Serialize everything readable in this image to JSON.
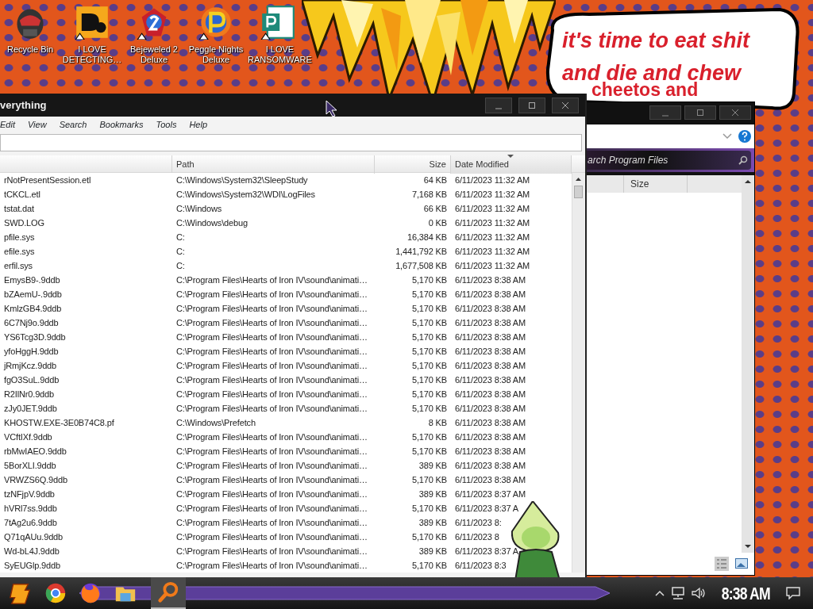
{
  "desktop_icons": [
    {
      "label": "Recycle Bin",
      "kind": "bin"
    },
    {
      "label": "I LOVE DETECTING…",
      "kind": "letters"
    },
    {
      "label": "Bejeweled 2 Deluxe",
      "kind": "gem"
    },
    {
      "label": "Peggle Nights Deluxe",
      "kind": "peggle"
    },
    {
      "label": "I LOVE RANSOMWARE",
      "kind": "project"
    }
  ],
  "speech_bubble": {
    "lines": [
      "it's time to eat shit",
      "and die and chew"
    ],
    "tail": "cheetos and"
  },
  "everything_window": {
    "title": "verything",
    "menu": [
      "Edit",
      "View",
      "Search",
      "Bookmarks",
      "Tools",
      "Help"
    ],
    "columns": [
      {
        "label": "Path",
        "sorted": false
      },
      {
        "label": "Size",
        "sorted": false
      },
      {
        "label": "Date Modified",
        "sorted": true
      }
    ],
    "rows": [
      {
        "name": "rNotPresentSession.etl",
        "path": "C:\\Windows\\System32\\SleepStudy",
        "size": "64 KB",
        "date": "6/11/2023 11:32 AM"
      },
      {
        "name": "tCKCL.etl",
        "path": "C:\\Windows\\System32\\WDI\\LogFiles",
        "size": "7,168 KB",
        "date": "6/11/2023 11:32 AM"
      },
      {
        "name": "tstat.dat",
        "path": "C:\\Windows",
        "size": "66 KB",
        "date": "6/11/2023 11:32 AM"
      },
      {
        "name": "SWD.LOG",
        "path": "C:\\Windows\\debug",
        "size": "0 KB",
        "date": "6/11/2023 11:32 AM"
      },
      {
        "name": "pfile.sys",
        "path": "C:",
        "size": "16,384 KB",
        "date": "6/11/2023 11:32 AM"
      },
      {
        "name": "efile.sys",
        "path": "C:",
        "size": "1,441,792 KB",
        "date": "6/11/2023 11:32 AM"
      },
      {
        "name": "erfil.sys",
        "path": "C:",
        "size": "1,677,508 KB",
        "date": "6/11/2023 11:32 AM"
      },
      {
        "name": "EmysB9-.9ddb",
        "path": "C:\\Program Files\\Hearts of Iron IV\\sound\\animati…",
        "size": "5,170 KB",
        "date": "6/11/2023 8:38 AM"
      },
      {
        "name": "bZAemU-.9ddb",
        "path": "C:\\Program Files\\Hearts of Iron IV\\sound\\animati…",
        "size": "5,170 KB",
        "date": "6/11/2023 8:38 AM"
      },
      {
        "name": "KmlzGB4.9ddb",
        "path": "C:\\Program Files\\Hearts of Iron IV\\sound\\animati…",
        "size": "5,170 KB",
        "date": "6/11/2023 8:38 AM"
      },
      {
        "name": "6C7Nj9o.9ddb",
        "path": "C:\\Program Files\\Hearts of Iron IV\\sound\\animati…",
        "size": "5,170 KB",
        "date": "6/11/2023 8:38 AM"
      },
      {
        "name": "YS6Tcg3D.9ddb",
        "path": "C:\\Program Files\\Hearts of Iron IV\\sound\\animati…",
        "size": "5,170 KB",
        "date": "6/11/2023 8:38 AM"
      },
      {
        "name": "yfoHggH.9ddb",
        "path": "C:\\Program Files\\Hearts of Iron IV\\sound\\animati…",
        "size": "5,170 KB",
        "date": "6/11/2023 8:38 AM"
      },
      {
        "name": "jRmjKcz.9ddb",
        "path": "C:\\Program Files\\Hearts of Iron IV\\sound\\animati…",
        "size": "5,170 KB",
        "date": "6/11/2023 8:38 AM"
      },
      {
        "name": "fgO3SuL.9ddb",
        "path": "C:\\Program Files\\Hearts of Iron IV\\sound\\animati…",
        "size": "5,170 KB",
        "date": "6/11/2023 8:38 AM"
      },
      {
        "name": "R2IlNr0.9ddb",
        "path": "C:\\Program Files\\Hearts of Iron IV\\sound\\animati…",
        "size": "5,170 KB",
        "date": "6/11/2023 8:38 AM"
      },
      {
        "name": "zJy0JET.9ddb",
        "path": "C:\\Program Files\\Hearts of Iron IV\\sound\\animati…",
        "size": "5,170 KB",
        "date": "6/11/2023 8:38 AM"
      },
      {
        "name": "KHOSTW.EXE-3E0B74C8.pf",
        "path": "C:\\Windows\\Prefetch",
        "size": "8 KB",
        "date": "6/11/2023 8:38 AM"
      },
      {
        "name": "VCftIXf.9ddb",
        "path": "C:\\Program Files\\Hearts of Iron IV\\sound\\animati…",
        "size": "5,170 KB",
        "date": "6/11/2023 8:38 AM"
      },
      {
        "name": "rbMwIAEO.9ddb",
        "path": "C:\\Program Files\\Hearts of Iron IV\\sound\\animati…",
        "size": "5,170 KB",
        "date": "6/11/2023 8:38 AM"
      },
      {
        "name": "5BorXLI.9ddb",
        "path": "C:\\Program Files\\Hearts of Iron IV\\sound\\animati…",
        "size": "389 KB",
        "date": "6/11/2023 8:38 AM"
      },
      {
        "name": "VRWZS6Q.9ddb",
        "path": "C:\\Program Files\\Hearts of Iron IV\\sound\\animati…",
        "size": "5,170 KB",
        "date": "6/11/2023 8:38 AM"
      },
      {
        "name": "tzNFjpV.9ddb",
        "path": "C:\\Program Files\\Hearts of Iron IV\\sound\\animati…",
        "size": "389 KB",
        "date": "6/11/2023 8:37 AM"
      },
      {
        "name": "hVRl7ss.9ddb",
        "path": "C:\\Program Files\\Hearts of Iron IV\\sound\\animati…",
        "size": "5,170 KB",
        "date": "6/11/2023 8:37 A"
      },
      {
        "name": "7tAg2u6.9ddb",
        "path": "C:\\Program Files\\Hearts of Iron IV\\sound\\animati…",
        "size": "389 KB",
        "date": "6/11/2023 8:"
      },
      {
        "name": "Q71qAUu.9ddb",
        "path": "C:\\Program Files\\Hearts of Iron IV\\sound\\animati…",
        "size": "5,170 KB",
        "date": "6/11/2023 8"
      },
      {
        "name": "Wd-bL4J.9ddb",
        "path": "C:\\Program Files\\Hearts of Iron IV\\sound\\animati…",
        "size": "389 KB",
        "date": "6/11/2023 8:37 A"
      },
      {
        "name": "SyEUGlp.9ddb",
        "path": "C:\\Program Files\\Hearts of Iron IV\\sound\\animati…",
        "size": "5,170 KB",
        "date": "6/11/2023 8:3"
      }
    ]
  },
  "explorer_window": {
    "search_placeholder": "arch Program Files",
    "columns": [
      "Size"
    ]
  },
  "taskbar": {
    "apps": [
      {
        "kind": "logo",
        "selected": false
      },
      {
        "kind": "chrome",
        "selected": false
      },
      {
        "kind": "firefox",
        "selected": false
      },
      {
        "kind": "folder",
        "selected": false
      },
      {
        "kind": "search",
        "selected": true
      }
    ],
    "clock": "8:38 AM"
  }
}
